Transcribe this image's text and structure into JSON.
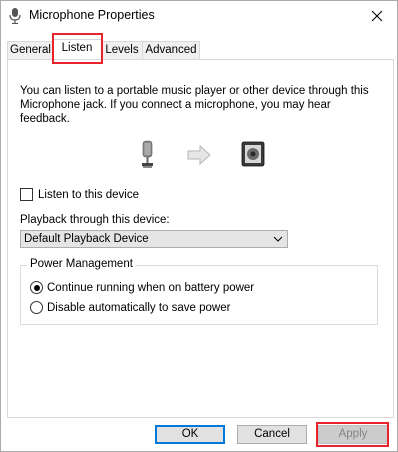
{
  "window": {
    "title": "Microphone Properties"
  },
  "tabs": [
    {
      "label": "General"
    },
    {
      "label": "Listen"
    },
    {
      "label": "Levels"
    },
    {
      "label": "Advanced"
    }
  ],
  "active_tab": "Listen",
  "listen": {
    "description": "You can listen to a portable music player or other device through this Microphone jack.  If you connect a microphone, you may hear feedback.",
    "listen_checkbox_label": "Listen to this device",
    "listen_checked": false,
    "playback_label": "Playback through this device:",
    "playback_value": "Default Playback Device",
    "power_group_label": "Power Management",
    "power_option_1": "Continue running when on battery power",
    "power_option_2": "Disable automatically to save power",
    "power_selected": 1
  },
  "buttons": {
    "ok": "OK",
    "cancel": "Cancel",
    "apply": "Apply"
  },
  "colors": {
    "highlight": "#e8232a",
    "default_button_border": "#0078d7"
  }
}
